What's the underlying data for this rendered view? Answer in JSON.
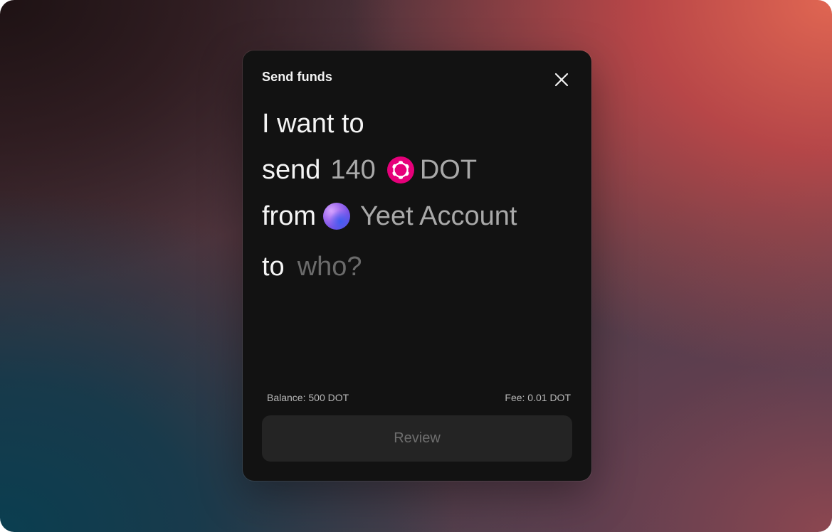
{
  "modal": {
    "title": "Send funds"
  },
  "sentence": {
    "line1": "I want to",
    "line2_prefix": "send",
    "amount": "140",
    "token": "DOT",
    "line3_prefix": "from",
    "account": "Yeet Account",
    "line4_prefix": "to",
    "recipient_placeholder": "who?"
  },
  "footer": {
    "balance": "Balance: 500 DOT",
    "fee": "Fee: 0.01 DOT"
  },
  "actions": {
    "review_label": "Review"
  },
  "icons": {
    "close": "close-icon",
    "token": "polkadot-icon",
    "account": "account-avatar"
  },
  "colors": {
    "modal_bg": "#121212",
    "token_brand": "#e6007a",
    "text_primary": "#f4f4f4",
    "text_secondary": "#a9a9a9",
    "placeholder": "#6b6b6b",
    "button_bg": "#242424"
  }
}
